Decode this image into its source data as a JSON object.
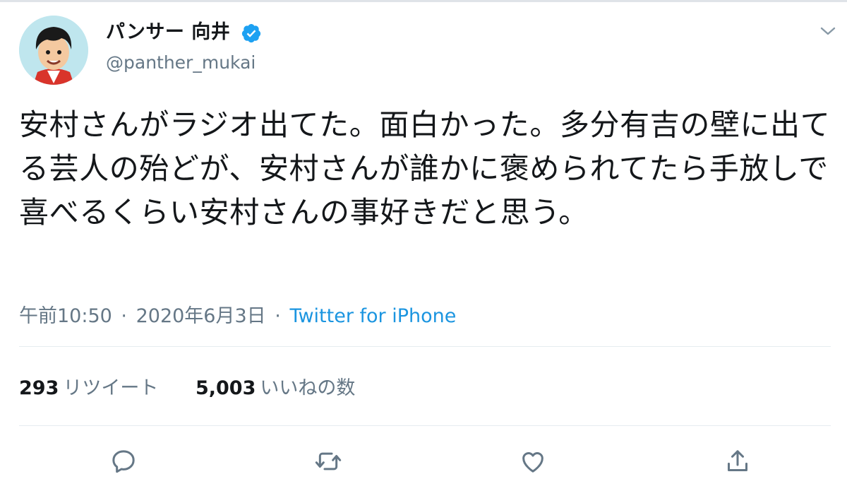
{
  "tweet": {
    "display_name": "パンサー 向井",
    "handle": "@panther_mukai",
    "text": "安村さんがラジオ出てた。面白かった。多分有吉の壁に出てる芸人の殆どが、安村さんが誰かに褒められてたら手放しで喜べるくらい安村さんの事好きだと思う。",
    "time": "午前10:50",
    "date": "2020年6月3日",
    "separator": "·",
    "source": "Twitter for iPhone"
  },
  "stats": {
    "retweets_count": "293",
    "retweets_label": "リツイート",
    "likes_count": "5,003",
    "likes_label": "いいねの数"
  },
  "icons": {
    "verified": "verified-badge-icon",
    "menu": "chevron-down-icon",
    "reply": "reply-icon",
    "retweet": "retweet-icon",
    "like": "heart-icon",
    "share": "share-icon"
  },
  "colors": {
    "accent": "#1b95e0",
    "text": "#14171a",
    "secondary": "#657786",
    "divider": "#e6ecf0"
  }
}
